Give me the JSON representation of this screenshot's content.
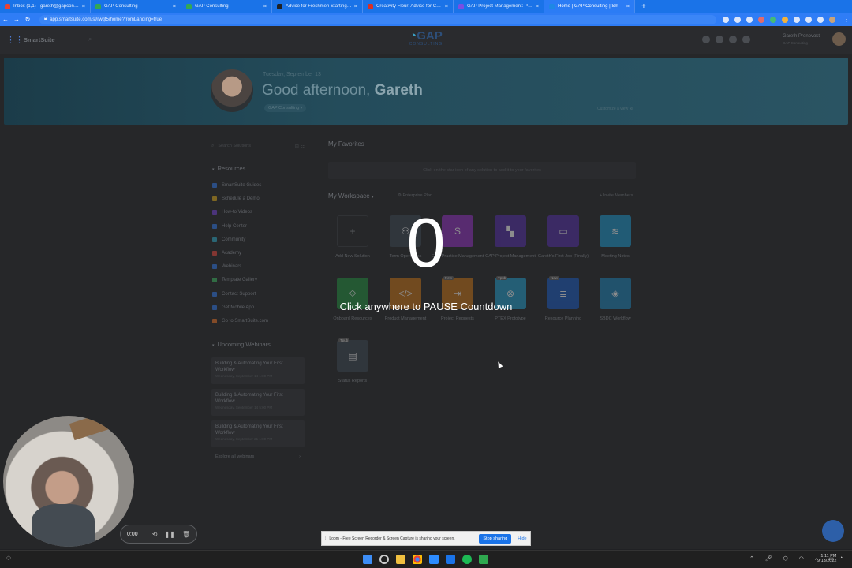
{
  "browser": {
    "tabs": [
      {
        "title": "Inbox (1,1) - gareth@gapconsulti",
        "color": "#ea4335"
      },
      {
        "title": "GAP Consulting",
        "color": "#34a853"
      },
      {
        "title": "GAP Consulting",
        "color": "#34a853"
      },
      {
        "title": "Advice for Freshmen Starting Co",
        "color": "#202124"
      },
      {
        "title": "Creativity Flour: Advice for Colle",
        "color": "#d93025"
      },
      {
        "title": "GAP Project Management: Proje",
        "color": "#7b4de3"
      },
      {
        "title": "Home | GAP Consulting | Sm",
        "color": "#1e88e5"
      }
    ],
    "new_tab": "+",
    "url": "app.smartsuite.com/sl/rwqf5/home?fromLanding=true"
  },
  "app": {
    "brand": "SmartSuite",
    "logo_text": "GAP",
    "logo_sub": "CONSULTING",
    "user_name": "Gareth Pronovost",
    "user_org": "GAP Consulting"
  },
  "hero": {
    "date": "Tuesday, September 13",
    "greeting": "Good afternoon,",
    "name": "Gareth",
    "workspace": "GAP Consulting ▾",
    "customize": "Customize a view ⊠"
  },
  "sidebar": {
    "search_placeholder": "Search Solutions",
    "resources_title": "Resources",
    "resources": [
      {
        "label": "SmartSuite Guides",
        "color": "#2f6fd1"
      },
      {
        "label": "Schedule a Demo",
        "color": "#c79a1d"
      },
      {
        "label": "How-to Videos",
        "color": "#6a3fc0"
      },
      {
        "label": "Help Center",
        "color": "#2f6fd1"
      },
      {
        "label": "Community",
        "color": "#2d9bb5"
      },
      {
        "label": "Academy",
        "color": "#d0443b"
      },
      {
        "label": "Webinars",
        "color": "#2f6fd1"
      },
      {
        "label": "Template Gallery",
        "color": "#3aa65b"
      },
      {
        "label": "Contact Support",
        "color": "#2f6fd1"
      },
      {
        "label": "Get Mobile App",
        "color": "#2f6fd1"
      },
      {
        "label": "Go to SmartSuite.com",
        "color": "#d06a28"
      }
    ],
    "webinars_title": "Upcoming Webinars",
    "webinars": [
      {
        "title": "Building & Automating Your First Workflow",
        "date": "Wednesday, September 14 1:00 PM"
      },
      {
        "title": "Building & Automating Your First Workflow",
        "date": "Wednesday, September 14 5:00 PM"
      },
      {
        "title": "Building & Automating Your First Workflow",
        "date": "Wednesday, September 21 1:00 PM"
      }
    ],
    "explore": "Explore all webinars",
    "explore_arrow": "›"
  },
  "main": {
    "favorites_title": "My Favorites",
    "favorites_hint": "Click on the star icon of any solution to add it to your favorites",
    "workspace_title": "My Workspace",
    "workspace_caret": "▾",
    "enterprise": "Enterprise Plan",
    "invite": "+ Invite Members",
    "add_plus": "+",
    "add_label": "Add New Solution",
    "solutions": [
      {
        "label": "Term Operations",
        "color": "#38404a",
        "glyph": "⚇",
        "badge": ""
      },
      {
        "label": "GAP Practice Management",
        "color": "#7a2fa0",
        "glyph": "S",
        "badge": ""
      },
      {
        "label": "GAP Project Management",
        "color": "#4a2c8c",
        "glyph": "▚",
        "badge": ""
      },
      {
        "label": "Gareth's First Job (Finally)",
        "color": "#4a2c8c",
        "glyph": "▭",
        "badge": ""
      },
      {
        "label": "Meeting Notes",
        "color": "#1f7fa8",
        "glyph": "≋",
        "badge": ""
      },
      {
        "label": "Onboard Resources",
        "color": "#237a3b",
        "glyph": "⟐",
        "badge": ""
      },
      {
        "label": "Product Management",
        "color": "#a4621a",
        "glyph": "</>",
        "badge": ""
      },
      {
        "label": "Project Requests",
        "color": "#a4621a",
        "glyph": "⇥",
        "badge": "New"
      },
      {
        "label": "PTEX Prototype",
        "color": "#2383a8",
        "glyph": "⊗",
        "badge": "Tpub"
      },
      {
        "label": "Resource Planning",
        "color": "#1d4fa0",
        "glyph": "≣",
        "badge": "New"
      },
      {
        "label": "SBDC Workflow",
        "color": "#1f6f9a",
        "glyph": "◈",
        "badge": ""
      },
      {
        "label": "Status Reports",
        "color": "#38404a",
        "glyph": "▤",
        "badge": "Tpub"
      }
    ]
  },
  "overlay": {
    "countdown": "0",
    "message": "Click anywhere to PAUSE Countdown"
  },
  "recorder": {
    "time": "0:00",
    "banner": "Loom - Free Screen Recorder & Screen Capture is sharing your screen.",
    "stop": "Stop sharing",
    "hide": "Hide"
  },
  "taskbar": {
    "time": "1:11 PM",
    "date": "9/13/2022"
  }
}
